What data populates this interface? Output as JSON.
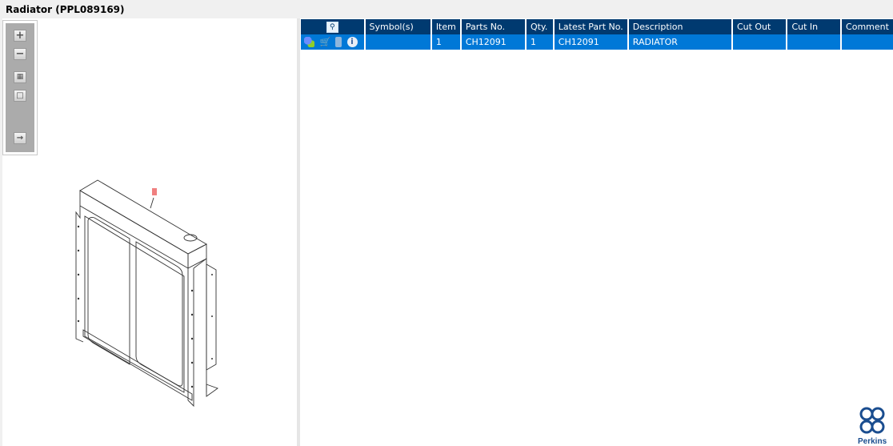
{
  "window": {
    "title": "Radiator (PPL089169)"
  },
  "toolbar": {
    "buttons": [
      "zoom-in",
      "zoom-out",
      "fit-all",
      "fit-page",
      "toggle-list"
    ]
  },
  "table": {
    "headers": [
      "",
      "Symbol(s)",
      "Item",
      "Parts No.",
      "Qty.",
      "Latest Part No.",
      "Description",
      "Cut Out",
      "Cut In",
      "Comment"
    ],
    "rows": [
      {
        "symbols": "",
        "item": "1",
        "parts_no": "CH12091",
        "qty": "1",
        "latest_part_no": "CH12091",
        "description": "RADIATOR",
        "cut_out": "",
        "cut_in": "",
        "comment": ""
      }
    ]
  },
  "diagram": {
    "callout": "1"
  },
  "brand": {
    "name": "Perkins"
  },
  "colors": {
    "header": "#003a70",
    "selected_row": "#0078d7",
    "callout": "#f08080"
  }
}
